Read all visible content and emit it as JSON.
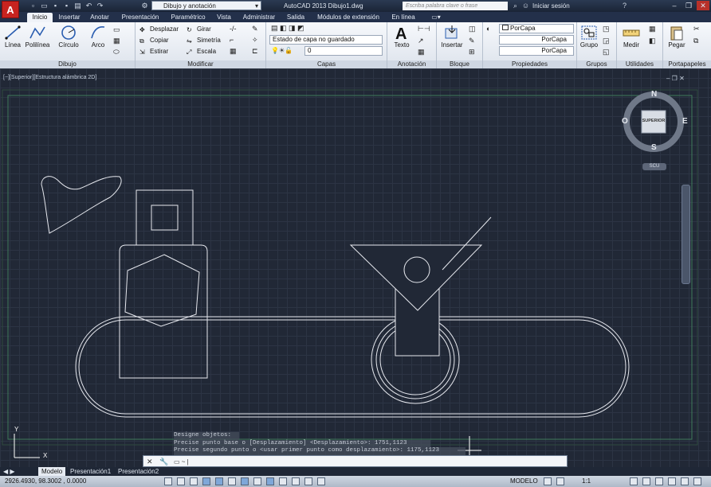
{
  "titlebar": {
    "workspace": "Dibujo y anotación",
    "app_title": "AutoCAD 2013    Dibujo1.dwg",
    "search_placeholder": "Escriba palabra clave o frase",
    "signin": "Iniciar sesión"
  },
  "ribbon_tabs": [
    "Inicio",
    "Insertar",
    "Anotar",
    "Presentación",
    "Paramétrico",
    "Vista",
    "Administrar",
    "Salida",
    "Módulos de extensión",
    "En línea"
  ],
  "draw": {
    "line": "Línea",
    "polyline": "Polilínea",
    "circle": "Círculo",
    "arc": "Arco",
    "label": "Dibujo"
  },
  "modify": {
    "move": "Desplazar",
    "rotate": "Girar",
    "copy": "Copiar",
    "mirror": "Simetría",
    "stretch": "Estirar",
    "scale": "Escala",
    "label": "Modificar"
  },
  "layers": {
    "state": "Estado de capa no guardado",
    "current": "0",
    "label": "Capas"
  },
  "annotation": {
    "text": "Texto",
    "label": "Anotación"
  },
  "block": {
    "insert": "Insertar",
    "label": "Bloque"
  },
  "properties": {
    "color": "PorCapa",
    "linetype": "PorCapa",
    "lineweight": "PorCapa",
    "label": "Propiedades"
  },
  "groups": {
    "group": "Grupo",
    "label": "Grupos"
  },
  "utilities": {
    "measure": "Medir",
    "label": "Utilidades"
  },
  "clipboard": {
    "paste": "Pegar",
    "label": "Portapapeles"
  },
  "viewport": {
    "label": "[−][Superior][Estructura alámbrica 2D]"
  },
  "viewcube": {
    "n": "N",
    "s": "S",
    "e": "E",
    "o": "O",
    "face": "SUPERIOR",
    "ucs": "SCU"
  },
  "command": {
    "history": [
      "Designe objetos:",
      "Precise punto base o [Desplazamiento] <Desplazamiento>: 1751,1123",
      "Precise segundo punto o <usar primer punto como desplazamiento>: 1175,1123"
    ]
  },
  "layout_tabs": [
    "Modelo",
    "Presentación1",
    "Presentación2"
  ],
  "status": {
    "coords": "2926.4930, 98.3002 , 0.0000",
    "space": "MODELO",
    "scale": "1:1"
  },
  "colors": {
    "accent": "#c8231f",
    "canvas": "#212836",
    "lines": "#e6e8ee"
  }
}
